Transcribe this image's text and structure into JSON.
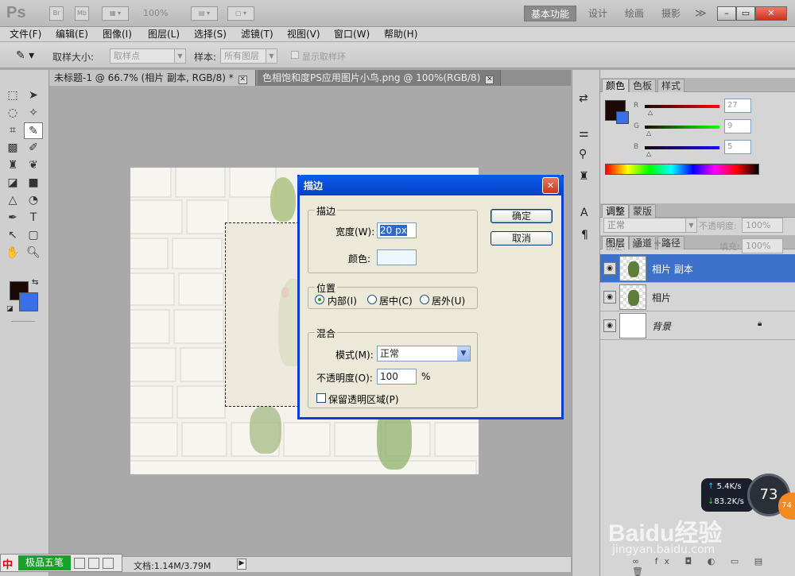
{
  "app": {
    "logo": "Ps",
    "br_label": "Br",
    "mb_label": "Mb",
    "zoom": "100%"
  },
  "workspace": {
    "active": "基本功能",
    "items": [
      "设计",
      "绘画",
      "摄影"
    ],
    "more": "≫"
  },
  "window_controls": {
    "minimize": "–",
    "restore": "▭",
    "close": "✕"
  },
  "menus": [
    "文件(F)",
    "编辑(E)",
    "图像(I)",
    "图层(L)",
    "选择(S)",
    "滤镜(T)",
    "视图(V)",
    "窗口(W)",
    "帮助(H)"
  ],
  "options": {
    "sample_size_label": "取样大小:",
    "sample_size_value": "取样点",
    "sample_label": "样本:",
    "sample_value": "所有图层",
    "show_ring_label": "显示取样环"
  },
  "doc_tabs": [
    {
      "title": "未标题-1 @ 66.7% (相片 副本, RGB/8) *",
      "close": "✕"
    },
    {
      "title": "色相饱和度PS应用图片小鸟.png @ 100%(RGB/8)",
      "close": "✕"
    }
  ],
  "status": {
    "doc_size": "文档:1.14M/3.79M"
  },
  "ime": {
    "logo": "中",
    "name": "极品五笔"
  },
  "color_panel": {
    "tabs": [
      "颜色",
      "色板",
      "样式"
    ],
    "r_label": "R",
    "g_label": "G",
    "b_label": "B",
    "r_value": "27",
    "g_value": "9",
    "b_value": "5",
    "fg_color": "#1b0905",
    "bg_color": "#3a6fe8"
  },
  "adjust_tabs": [
    "调整",
    "蒙版"
  ],
  "layers_panel": {
    "tabs": [
      "图层",
      "通道",
      "路径"
    ],
    "blend_mode": "正常",
    "opacity_label": "不透明度:",
    "opacity_value": "100%",
    "lock_label": "锁定:",
    "fill_label": "填充:",
    "fill_value": "100%",
    "layers": [
      {
        "name": "相片 副本",
        "selected": true
      },
      {
        "name": "相片",
        "selected": false
      },
      {
        "name": "背景",
        "selected": false
      }
    ]
  },
  "dialog": {
    "title": "描边",
    "close": "✕",
    "stroke_group": "描边",
    "width_label": "宽度(W):",
    "width_value": "20 px",
    "color_label": "颜色:",
    "stroke_color": "#eef7ff",
    "position_group": "位置",
    "position_options": [
      "内部(I)",
      "居中(C)",
      "居外(U)"
    ],
    "position_selected": "内部(I)",
    "blend_group": "混合",
    "mode_label": "模式(M):",
    "mode_value": "正常",
    "opacity_label": "不透明度(O):",
    "opacity_value": "100",
    "opacity_unit": "%",
    "preserve_label": "保留透明区域(P)",
    "ok": "确定",
    "cancel": "取消"
  },
  "net_widget": {
    "up": "5.4K/s",
    "down": "83.2K/s",
    "cpu": "73",
    "badge": "74"
  },
  "watermark": {
    "logo": "Baidu经验",
    "url": "jingyan.baidu.com"
  }
}
